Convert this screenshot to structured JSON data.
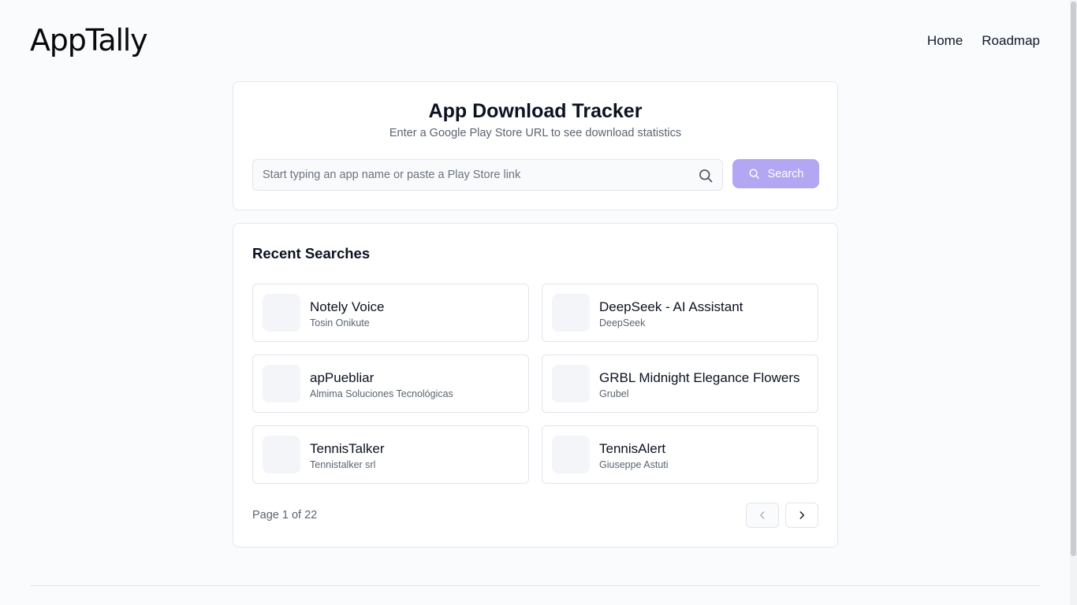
{
  "brand": {
    "name": "AppTally"
  },
  "nav": {
    "items": [
      {
        "label": "Home"
      },
      {
        "label": "Roadmap"
      }
    ]
  },
  "search": {
    "title": "App Download Tracker",
    "subtitle": "Enter a Google Play Store URL to see download statistics",
    "placeholder": "Start typing an app name or paste a Play Store link",
    "value": "",
    "button_label": "Search",
    "button_color": "#b3a6f2"
  },
  "recent": {
    "title": "Recent Searches",
    "apps": [
      {
        "name": "Notely Voice",
        "developer": "Tosin Onikute"
      },
      {
        "name": "DeepSeek - AI Assistant",
        "developer": "DeepSeek"
      },
      {
        "name": "apPuebliar",
        "developer": "Almima Soluciones Tecnológicas"
      },
      {
        "name": "GRBL Midnight Elegance Flowers",
        "developer": "Grubel"
      },
      {
        "name": "TennisTalker",
        "developer": "Tennistalker srl"
      },
      {
        "name": "TennisAlert",
        "developer": "Giuseppe Astuti"
      }
    ],
    "pagination": {
      "text": "Page 1 of 22",
      "current": 1,
      "total": 22
    }
  },
  "icons": {
    "search": "search-icon",
    "prev": "chevron-left-icon",
    "next": "chevron-right-icon"
  }
}
